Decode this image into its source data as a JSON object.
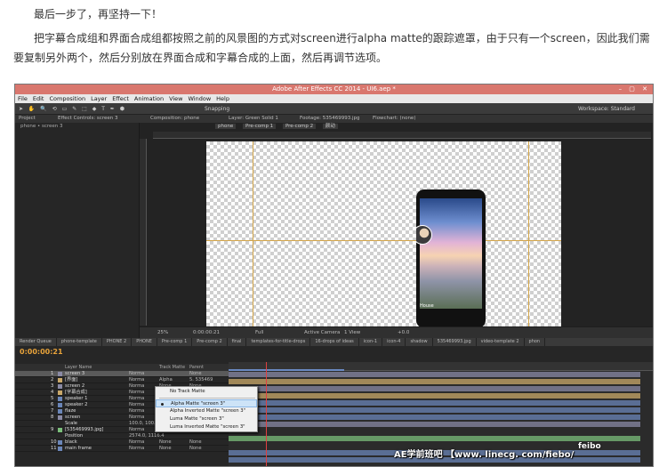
{
  "article": {
    "p1": "最后一步了，再坚持一下！",
    "p2": "把字幕合成组和界面合成组都按照之前的风景图的方式对screen进行alpha matte的跟踪遮罩，由于只有一个screen，因此我们需要复制另外两个，然后分别放在界面合成和字幕合成的上面，然后再调节选项。"
  },
  "app": {
    "title": "Adobe After Effects CC 2014 - UI6.aep *",
    "menu": [
      "File",
      "Edit",
      "Composition",
      "Layer",
      "Effect",
      "Animation",
      "View",
      "Window",
      "Help"
    ],
    "snapping": "Snapping",
    "workspace": "Workspace:  Standard"
  },
  "panels": {
    "project": "Project",
    "effect_controls": "Effect Controls: screen 3",
    "composition": "Composition: phone",
    "layer": "Layer: Green Solid 1",
    "footage": "Footage: 535469993.jpg",
    "flowchart": "Flowchart: (none)",
    "project_item": "phone • screen 3",
    "comp_tabs": [
      "phone",
      "Pre-comp 1",
      "Pre-comp 2",
      "颜动"
    ]
  },
  "viewer": {
    "zoom": "25%",
    "timecode": "0:00:00:21",
    "resolution": "Full",
    "camera": "Active Camera",
    "views": "1 View",
    "offset": "+0.0",
    "phone_text": "House"
  },
  "timeline": {
    "tabs": [
      "Render Queue",
      "phone-template",
      "PHONE 2",
      "PHONE",
      "Pre-comp 1",
      "Pre-comp 2",
      "final",
      "templates-for-title-drops",
      "16-drops of ideas",
      "icon-1",
      "icon-4",
      "shadow",
      "535469993.jpg",
      "video-template 2",
      "phon"
    ],
    "current_time": "0:00:00:21",
    "columns": {
      "layer_name": "Layer Name",
      "track_matte": "Track Matte",
      "parent": "Parent"
    },
    "layers": [
      {
        "num": "1",
        "name": "screen 3",
        "mode": "Norma",
        "tm": "",
        "parent": "None",
        "color": "#8a8aa5"
      },
      {
        "num": "2",
        "name": "[界面]",
        "mode": "Norma",
        "tm": "Alpha",
        "parent": "5. 535469",
        "color": "#c9a86a"
      },
      {
        "num": "3",
        "name": "screen 2",
        "mode": "Norma",
        "tm": "None",
        "parent": "None",
        "color": "#8a8aa5"
      },
      {
        "num": "4",
        "name": "[字幕合成]",
        "mode": "Norma",
        "tm": "",
        "parent": "None",
        "color": "#c9a86a"
      },
      {
        "num": "5",
        "name": "speaker 1",
        "mode": "Norma",
        "tm": "None",
        "parent": "None",
        "color": "#6b86b8"
      },
      {
        "num": "6",
        "name": "speaker 2",
        "mode": "Norma",
        "tm": "None",
        "parent": "None",
        "color": "#6b86b8"
      },
      {
        "num": "7",
        "name": "flaze",
        "mode": "Norma",
        "tm": "None",
        "parent": "None",
        "color": "#6b86b8"
      },
      {
        "num": "8",
        "name": "screen",
        "mode": "Norma",
        "tm": "None",
        "parent": "None",
        "color": "#8a8aa5"
      },
      {
        "num": "",
        "name": "Scale",
        "mode": "100.0, 100.0%",
        "tm": "",
        "parent": "",
        "color": ""
      },
      {
        "num": "9",
        "name": "[535469993.jpg]",
        "mode": "Norma",
        "tm": "None",
        "parent": "None",
        "color": "#7bbf7b"
      },
      {
        "num": "",
        "name": "Position",
        "mode": "2574.0, 1116.4",
        "tm": "",
        "parent": "",
        "color": ""
      },
      {
        "num": "10",
        "name": "black",
        "mode": "Norma",
        "tm": "None",
        "parent": "None",
        "color": "#6b86b8"
      },
      {
        "num": "11",
        "name": "main frame",
        "mode": "Norma",
        "tm": "None",
        "parent": "None",
        "color": "#6b86b8"
      }
    ]
  },
  "matte_menu": {
    "options": [
      "No Track Matte",
      "Alpha Matte \"screen 3\"",
      "Alpha Inverted Matte \"screen 3\"",
      "Luma Matte \"screen 3\"",
      "Luma Inverted Matte \"screen 3\""
    ],
    "selected_index": 1
  },
  "watermark": {
    "text": "AE学前班吧 【www. linecg. com/fiebo/ ",
    "text2": "feibo"
  }
}
